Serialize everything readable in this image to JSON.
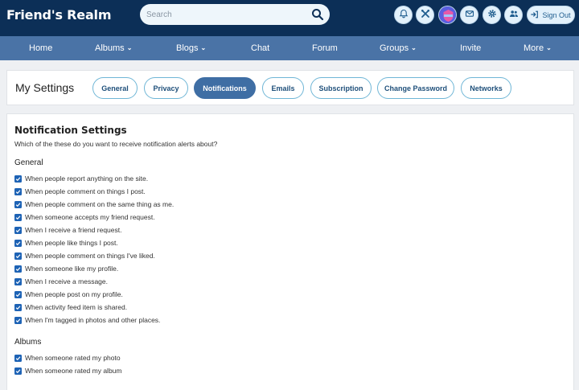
{
  "header": {
    "site_title": "Friend's Realm",
    "search_placeholder": "Search",
    "signout_label": "Sign Out"
  },
  "nav": {
    "items": [
      {
        "label": "Home",
        "dropdown": false
      },
      {
        "label": "Albums",
        "dropdown": true
      },
      {
        "label": "Blogs",
        "dropdown": true
      },
      {
        "label": "Chat",
        "dropdown": false
      },
      {
        "label": "Forum",
        "dropdown": false
      },
      {
        "label": "Groups",
        "dropdown": true
      },
      {
        "label": "Invite",
        "dropdown": false
      },
      {
        "label": "More",
        "dropdown": true
      }
    ]
  },
  "settings": {
    "title": "My Settings",
    "tabs": [
      {
        "label": "General"
      },
      {
        "label": "Privacy"
      },
      {
        "label": "Notifications",
        "active": true
      },
      {
        "label": "Emails"
      },
      {
        "label": "Subscription"
      },
      {
        "label": "Change Password"
      },
      {
        "label": "Networks"
      }
    ]
  },
  "notifications": {
    "title": "Notification Settings",
    "subtitle": "Which of the these do you want to receive notification alerts about?",
    "general_title": "General",
    "general": [
      "When people report anything on the site.",
      "When people comment on things I post.",
      "When people comment on the same thing as me.",
      "When someone accepts my friend request.",
      "When I receive a friend request.",
      "When people like things I post.",
      "When people comment on things I've liked.",
      "When someone like my profile.",
      "When I receive a message.",
      "When people post on my profile.",
      "When activity feed item is shared.",
      "When I'm tagged in photos and other places."
    ],
    "albums_title": "Albums",
    "albums": [
      "When someone rated my photo",
      "When someone rated my album"
    ]
  },
  "colors": {
    "header_bg": "#0c2f57",
    "nav_bg": "#4a73a6",
    "active_tab": "#3f6ea4",
    "checkbox": "#1e63b5"
  }
}
